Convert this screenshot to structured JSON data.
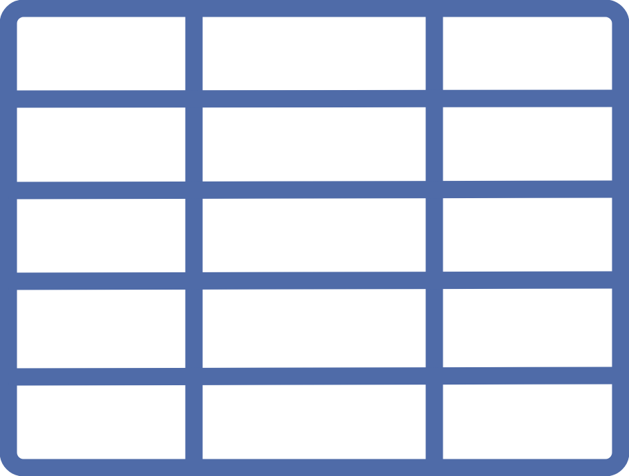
{
  "icon": {
    "name": "table-grid-icon",
    "stroke_color": "#4F6BA8",
    "background_color": "#FFFFFF",
    "rows": 5,
    "columns": 3
  }
}
